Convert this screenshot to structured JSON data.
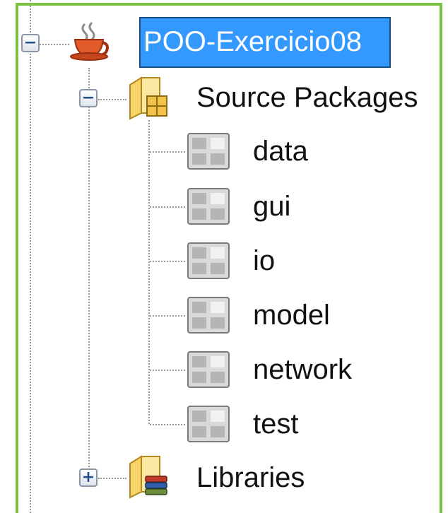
{
  "project": {
    "name": "POO-Exercicio08",
    "expanded": true,
    "icon": "java-project-coffee-cup-icon"
  },
  "tree": {
    "source_packages": {
      "label": "Source Packages",
      "expanded": true,
      "icon": "source-folder-icon",
      "packages": [
        {
          "label": "data",
          "icon": "package-icon"
        },
        {
          "label": "gui",
          "icon": "package-icon"
        },
        {
          "label": "io",
          "icon": "package-icon"
        },
        {
          "label": "model",
          "icon": "package-icon"
        },
        {
          "label": "network",
          "icon": "package-icon"
        },
        {
          "label": "test",
          "icon": "package-icon"
        }
      ]
    },
    "libraries": {
      "label": "Libraries",
      "expanded": false,
      "icon": "libraries-folder-icon"
    },
    "toggle_expanded_symbol": "−",
    "toggle_collapsed_symbol": "+"
  },
  "colors": {
    "selection": "#3399ff",
    "frame": "#7dc242",
    "tree_lines": "#9a9a9a"
  }
}
